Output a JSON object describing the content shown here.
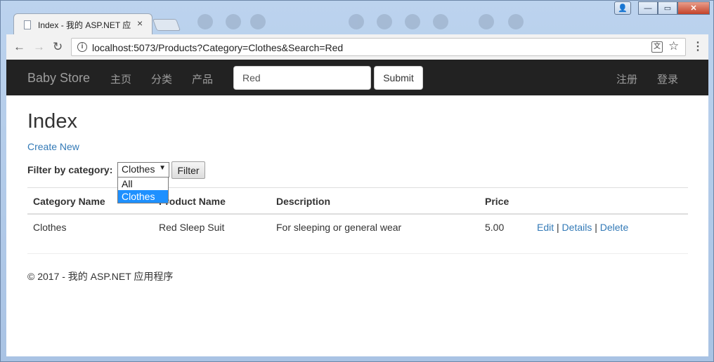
{
  "browser": {
    "tab_title": "Index - 我的 ASP.NET 应",
    "tab_close": "×",
    "url": "localhost:5073/Products?Category=Clothes&Search=Red",
    "back": "←",
    "forward": "→",
    "reload": "↻",
    "star": "☆",
    "menu": "⋮",
    "translate": "文",
    "info": "i",
    "win_minimize": "—",
    "win_maximize": "▭",
    "win_close": "✕",
    "profile": "👤"
  },
  "navbar": {
    "brand": "Baby Store",
    "links": [
      "主页",
      "分类",
      "产品"
    ],
    "search_value": "Red",
    "submit_label": "Submit",
    "right_links": [
      "注册",
      "登录"
    ]
  },
  "main": {
    "title": "Index",
    "create_new": "Create New",
    "filter_label": "Filter by category:",
    "category_selected": "Clothes",
    "category_options": [
      "All",
      "Clothes"
    ],
    "filter_button": "Filter",
    "table": {
      "headers": [
        "Category Name",
        "Product Name",
        "Description",
        "Price"
      ],
      "rows": [
        {
          "category": "Clothes",
          "product": "Red Sleep Suit",
          "description": "For sleeping or general wear",
          "price": "5.00",
          "actions": [
            "Edit",
            "Details",
            "Delete"
          ]
        }
      ]
    }
  },
  "footer": {
    "text": "© 2017 - 我的 ASP.NET 应用程序"
  },
  "colors": {
    "navbar_bg": "#222222",
    "navbar_text": "#9d9d9d",
    "link": "#337ab7",
    "dropdown_highlight": "#1e90ff"
  }
}
